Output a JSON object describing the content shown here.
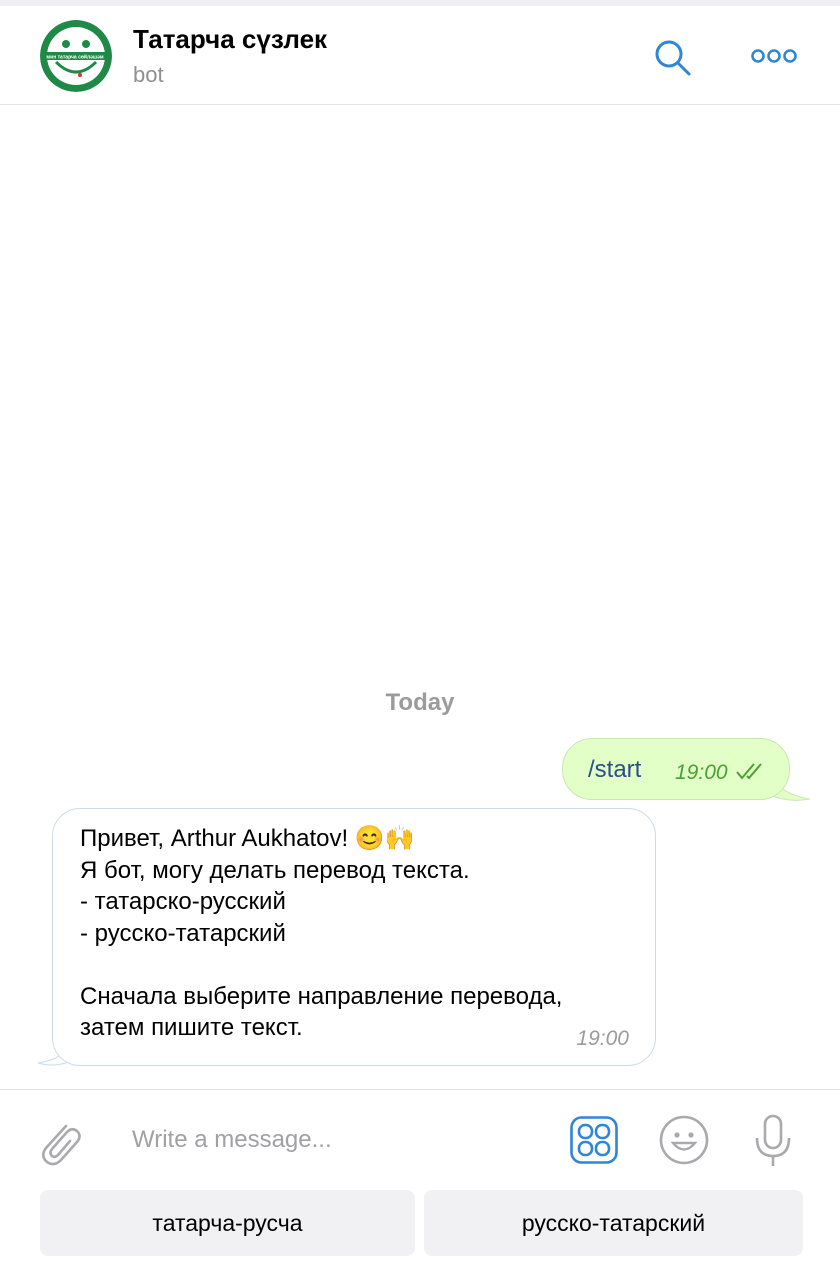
{
  "header": {
    "title": "Татарча сүзлек",
    "subtitle": "bot",
    "avatar_text": "мин татарча сөйләшәм"
  },
  "chat": {
    "date_label": "Today",
    "outgoing": {
      "text": "/start",
      "time": "19:00",
      "status": "read"
    },
    "incoming": {
      "lines": [
        "Привет, Arthur Aukhatov!",
        "Я бот, могу делать перевод текста.",
        "- татарско-русский",
        "- русско-татарский",
        "",
        "Сначала выберите направление перевода,",
        "затем пишите текст."
      ],
      "emojis": [
        "😊",
        "🙌"
      ],
      "time": "19:00"
    }
  },
  "input": {
    "placeholder": "Write a message..."
  },
  "keyboard": {
    "buttons": [
      "татарча-русча",
      "русско-татарский"
    ]
  },
  "colors": {
    "accent": "#2f86d6",
    "outgoing_bubble": "#e1ffc7",
    "outgoing_text": "#2b4f8a",
    "outgoing_time": "#4aa032",
    "avatar_green": "#1f8a47",
    "muted": "#9b9b9b"
  },
  "icons": [
    "search-icon",
    "more-icon",
    "attach-icon",
    "keyboard-icon",
    "emoji-icon",
    "mic-icon",
    "double-check-icon"
  ]
}
